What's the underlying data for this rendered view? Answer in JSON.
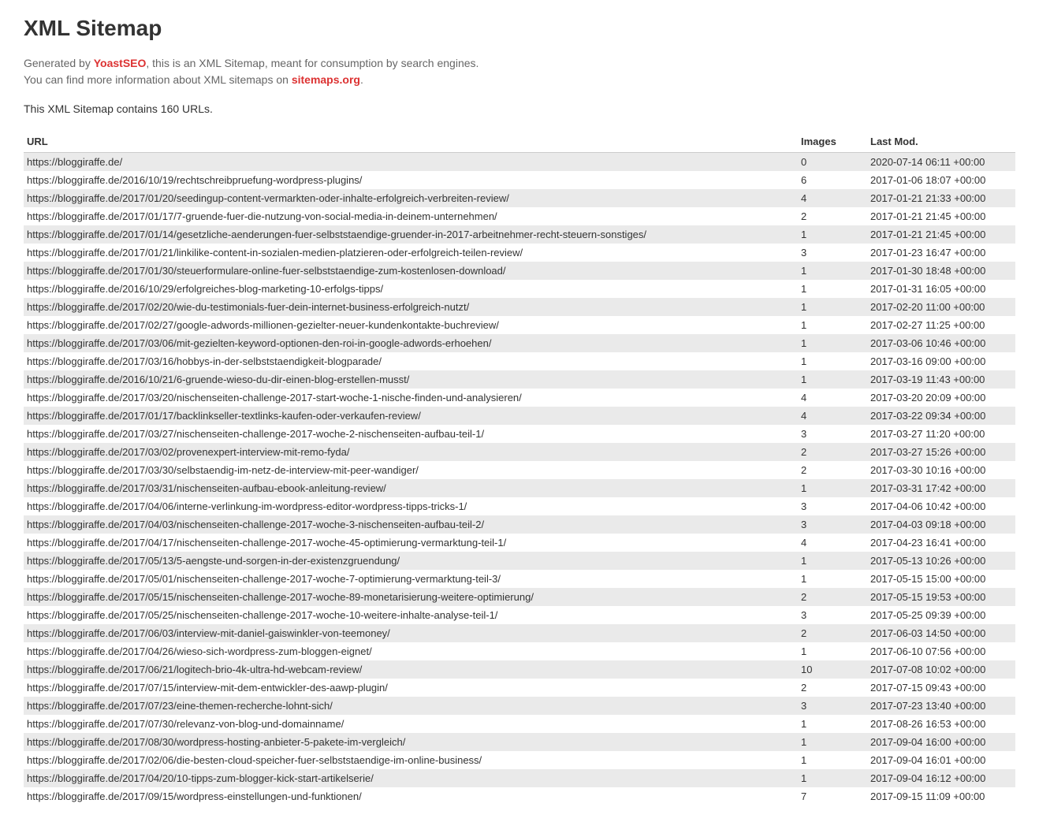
{
  "title": "XML Sitemap",
  "intro": {
    "prefix": "Generated by ",
    "yoast": "YoastSEO",
    "mid": ", this is an XML Sitemap, meant for consumption by search engines.",
    "line2prefix": "You can find more information about XML sitemaps on ",
    "sitemapsLink": "sitemaps.org",
    "line2suffix": "."
  },
  "countText": "This XML Sitemap contains 160 URLs.",
  "headers": {
    "url": "URL",
    "images": "Images",
    "lastmod": "Last Mod."
  },
  "rows": [
    {
      "url": "https://bloggiraffe.de/",
      "images": "0",
      "lastmod": "2020-07-14 06:11 +00:00"
    },
    {
      "url": "https://bloggiraffe.de/2016/10/19/rechtschreibpruefung-wordpress-plugins/",
      "images": "6",
      "lastmod": "2017-01-06 18:07 +00:00"
    },
    {
      "url": "https://bloggiraffe.de/2017/01/20/seedingup-content-vermarkten-oder-inhalte-erfolgreich-verbreiten-review/",
      "images": "4",
      "lastmod": "2017-01-21 21:33 +00:00"
    },
    {
      "url": "https://bloggiraffe.de/2017/01/17/7-gruende-fuer-die-nutzung-von-social-media-in-deinem-unternehmen/",
      "images": "2",
      "lastmod": "2017-01-21 21:45 +00:00"
    },
    {
      "url": "https://bloggiraffe.de/2017/01/14/gesetzliche-aenderungen-fuer-selbststaendige-gruender-in-2017-arbeitnehmer-recht-steuern-sonstiges/",
      "images": "1",
      "lastmod": "2017-01-21 21:45 +00:00"
    },
    {
      "url": "https://bloggiraffe.de/2017/01/21/linkilike-content-in-sozialen-medien-platzieren-oder-erfolgreich-teilen-review/",
      "images": "3",
      "lastmod": "2017-01-23 16:47 +00:00"
    },
    {
      "url": "https://bloggiraffe.de/2017/01/30/steuerformulare-online-fuer-selbststaendige-zum-kostenlosen-download/",
      "images": "1",
      "lastmod": "2017-01-30 18:48 +00:00"
    },
    {
      "url": "https://bloggiraffe.de/2016/10/29/erfolgreiches-blog-marketing-10-erfolgs-tipps/",
      "images": "1",
      "lastmod": "2017-01-31 16:05 +00:00"
    },
    {
      "url": "https://bloggiraffe.de/2017/02/20/wie-du-testimonials-fuer-dein-internet-business-erfolgreich-nutzt/",
      "images": "1",
      "lastmod": "2017-02-20 11:00 +00:00"
    },
    {
      "url": "https://bloggiraffe.de/2017/02/27/google-adwords-millionen-gezielter-neuer-kundenkontakte-buchreview/",
      "images": "1",
      "lastmod": "2017-02-27 11:25 +00:00"
    },
    {
      "url": "https://bloggiraffe.de/2017/03/06/mit-gezielten-keyword-optionen-den-roi-in-google-adwords-erhoehen/",
      "images": "1",
      "lastmod": "2017-03-06 10:46 +00:00"
    },
    {
      "url": "https://bloggiraffe.de/2017/03/16/hobbys-in-der-selbststaendigkeit-blogparade/",
      "images": "1",
      "lastmod": "2017-03-16 09:00 +00:00"
    },
    {
      "url": "https://bloggiraffe.de/2016/10/21/6-gruende-wieso-du-dir-einen-blog-erstellen-musst/",
      "images": "1",
      "lastmod": "2017-03-19 11:43 +00:00"
    },
    {
      "url": "https://bloggiraffe.de/2017/03/20/nischenseiten-challenge-2017-start-woche-1-nische-finden-und-analysieren/",
      "images": "4",
      "lastmod": "2017-03-20 20:09 +00:00"
    },
    {
      "url": "https://bloggiraffe.de/2017/01/17/backlinkseller-textlinks-kaufen-oder-verkaufen-review/",
      "images": "4",
      "lastmod": "2017-03-22 09:34 +00:00"
    },
    {
      "url": "https://bloggiraffe.de/2017/03/27/nischenseiten-challenge-2017-woche-2-nischenseiten-aufbau-teil-1/",
      "images": "3",
      "lastmod": "2017-03-27 11:20 +00:00"
    },
    {
      "url": "https://bloggiraffe.de/2017/03/02/provenexpert-interview-mit-remo-fyda/",
      "images": "2",
      "lastmod": "2017-03-27 15:26 +00:00"
    },
    {
      "url": "https://bloggiraffe.de/2017/03/30/selbstaendig-im-netz-de-interview-mit-peer-wandiger/",
      "images": "2",
      "lastmod": "2017-03-30 10:16 +00:00"
    },
    {
      "url": "https://bloggiraffe.de/2017/03/31/nischenseiten-aufbau-ebook-anleitung-review/",
      "images": "1",
      "lastmod": "2017-03-31 17:42 +00:00"
    },
    {
      "url": "https://bloggiraffe.de/2017/04/06/interne-verlinkung-im-wordpress-editor-wordpress-tipps-tricks-1/",
      "images": "3",
      "lastmod": "2017-04-06 10:42 +00:00"
    },
    {
      "url": "https://bloggiraffe.de/2017/04/03/nischenseiten-challenge-2017-woche-3-nischenseiten-aufbau-teil-2/",
      "images": "3",
      "lastmod": "2017-04-03 09:18 +00:00"
    },
    {
      "url": "https://bloggiraffe.de/2017/04/17/nischenseiten-challenge-2017-woche-45-optimierung-vermarktung-teil-1/",
      "images": "4",
      "lastmod": "2017-04-23 16:41 +00:00"
    },
    {
      "url": "https://bloggiraffe.de/2017/05/13/5-aengste-und-sorgen-in-der-existenzgruendung/",
      "images": "1",
      "lastmod": "2017-05-13 10:26 +00:00"
    },
    {
      "url": "https://bloggiraffe.de/2017/05/01/nischenseiten-challenge-2017-woche-7-optimierung-vermarktung-teil-3/",
      "images": "1",
      "lastmod": "2017-05-15 15:00 +00:00"
    },
    {
      "url": "https://bloggiraffe.de/2017/05/15/nischenseiten-challenge-2017-woche-89-monetarisierung-weitere-optimierung/",
      "images": "2",
      "lastmod": "2017-05-15 19:53 +00:00"
    },
    {
      "url": "https://bloggiraffe.de/2017/05/25/nischenseiten-challenge-2017-woche-10-weitere-inhalte-analyse-teil-1/",
      "images": "3",
      "lastmod": "2017-05-25 09:39 +00:00"
    },
    {
      "url": "https://bloggiraffe.de/2017/06/03/interview-mit-daniel-gaiswinkler-von-teemoney/",
      "images": "2",
      "lastmod": "2017-06-03 14:50 +00:00"
    },
    {
      "url": "https://bloggiraffe.de/2017/04/26/wieso-sich-wordpress-zum-bloggen-eignet/",
      "images": "1",
      "lastmod": "2017-06-10 07:56 +00:00"
    },
    {
      "url": "https://bloggiraffe.de/2017/06/21/logitech-brio-4k-ultra-hd-webcam-review/",
      "images": "10",
      "lastmod": "2017-07-08 10:02 +00:00"
    },
    {
      "url": "https://bloggiraffe.de/2017/07/15/interview-mit-dem-entwickler-des-aawp-plugin/",
      "images": "2",
      "lastmod": "2017-07-15 09:43 +00:00"
    },
    {
      "url": "https://bloggiraffe.de/2017/07/23/eine-themen-recherche-lohnt-sich/",
      "images": "3",
      "lastmod": "2017-07-23 13:40 +00:00"
    },
    {
      "url": "https://bloggiraffe.de/2017/07/30/relevanz-von-blog-und-domainname/",
      "images": "1",
      "lastmod": "2017-08-26 16:53 +00:00"
    },
    {
      "url": "https://bloggiraffe.de/2017/08/30/wordpress-hosting-anbieter-5-pakete-im-vergleich/",
      "images": "1",
      "lastmod": "2017-09-04 16:00 +00:00"
    },
    {
      "url": "https://bloggiraffe.de/2017/02/06/die-besten-cloud-speicher-fuer-selbststaendige-im-online-business/",
      "images": "1",
      "lastmod": "2017-09-04 16:01 +00:00"
    },
    {
      "url": "https://bloggiraffe.de/2017/04/20/10-tipps-zum-blogger-kick-start-artikelserie/",
      "images": "1",
      "lastmod": "2017-09-04 16:12 +00:00"
    },
    {
      "url": "https://bloggiraffe.de/2017/09/15/wordpress-einstellungen-und-funktionen/",
      "images": "7",
      "lastmod": "2017-09-15 11:09 +00:00"
    }
  ]
}
